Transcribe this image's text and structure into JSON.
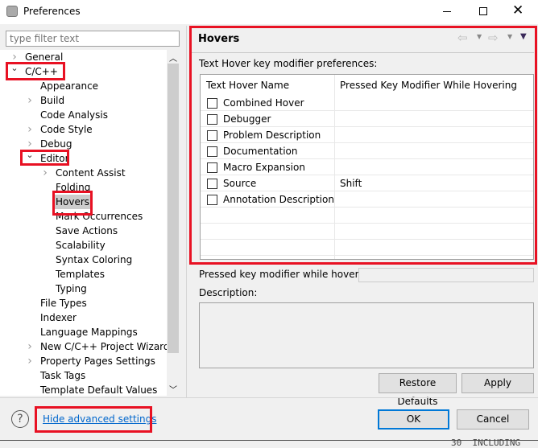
{
  "window": {
    "title": "Preferences",
    "minimize_icon": "minimize-icon",
    "maximize_icon": "maximize-icon",
    "close_icon": "close-icon"
  },
  "filter": {
    "placeholder": "type filter text"
  },
  "tree": [
    {
      "label": "General",
      "level": 0,
      "arrow": "collapsed"
    },
    {
      "label": "C/C++",
      "level": 0,
      "arrow": "expanded"
    },
    {
      "label": "Appearance",
      "level": 1,
      "arrow": "none"
    },
    {
      "label": "Build",
      "level": 1,
      "arrow": "collapsed"
    },
    {
      "label": "Code Analysis",
      "level": 1,
      "arrow": "none"
    },
    {
      "label": "Code Style",
      "level": 1,
      "arrow": "collapsed"
    },
    {
      "label": "Debug",
      "level": 1,
      "arrow": "collapsed"
    },
    {
      "label": "Editor",
      "level": 1,
      "arrow": "expanded"
    },
    {
      "label": "Content Assist",
      "level": 2,
      "arrow": "collapsed"
    },
    {
      "label": "Folding",
      "level": 2,
      "arrow": "none"
    },
    {
      "label": "Hovers",
      "level": 2,
      "arrow": "none",
      "selected": true
    },
    {
      "label": "Mark Occurrences",
      "level": 2,
      "arrow": "none"
    },
    {
      "label": "Save Actions",
      "level": 2,
      "arrow": "none"
    },
    {
      "label": "Scalability",
      "level": 2,
      "arrow": "none"
    },
    {
      "label": "Syntax Coloring",
      "level": 2,
      "arrow": "none"
    },
    {
      "label": "Templates",
      "level": 2,
      "arrow": "none"
    },
    {
      "label": "Typing",
      "level": 2,
      "arrow": "none"
    },
    {
      "label": "File Types",
      "level": 1,
      "arrow": "none"
    },
    {
      "label": "Indexer",
      "level": 1,
      "arrow": "none"
    },
    {
      "label": "Language Mappings",
      "level": 1,
      "arrow": "none"
    },
    {
      "label": "New C/C++ Project Wizard",
      "level": 1,
      "arrow": "collapsed"
    },
    {
      "label": "Property Pages Settings",
      "level": 1,
      "arrow": "collapsed"
    },
    {
      "label": "Task Tags",
      "level": 1,
      "arrow": "none"
    },
    {
      "label": "Template Default Values",
      "level": 1,
      "arrow": "none"
    }
  ],
  "page": {
    "title": "Hovers",
    "section_label": "Text Hover key modifier preferences:",
    "columns": [
      "Text Hover Name",
      "Pressed Key Modifier While Hovering"
    ],
    "rows": [
      {
        "name": "Combined Hover",
        "modifier": "",
        "checked": false
      },
      {
        "name": "Debugger",
        "modifier": "",
        "checked": false
      },
      {
        "name": "Problem Description",
        "modifier": "",
        "checked": false
      },
      {
        "name": "Documentation",
        "modifier": "",
        "checked": false
      },
      {
        "name": "Macro Expansion",
        "modifier": "",
        "checked": false
      },
      {
        "name": "Source",
        "modifier": "Shift",
        "checked": false
      },
      {
        "name": "Annotation Description",
        "modifier": "",
        "checked": false
      }
    ],
    "modifier_label": "Pressed key modifier while hovering:",
    "modifier_value": "",
    "description_label": "Description:",
    "restore_defaults": "Restore Defaults",
    "apply": "Apply"
  },
  "footer": {
    "help_icon": "help-icon",
    "advanced_link": "Hide advanced settings",
    "ok": "OK",
    "cancel": "Cancel"
  },
  "background_text": "30  INCLUDING",
  "colors": {
    "highlight": "#e81123",
    "link": "#0066cc",
    "ok_border": "#0078d7",
    "selection": "#cccccc"
  }
}
